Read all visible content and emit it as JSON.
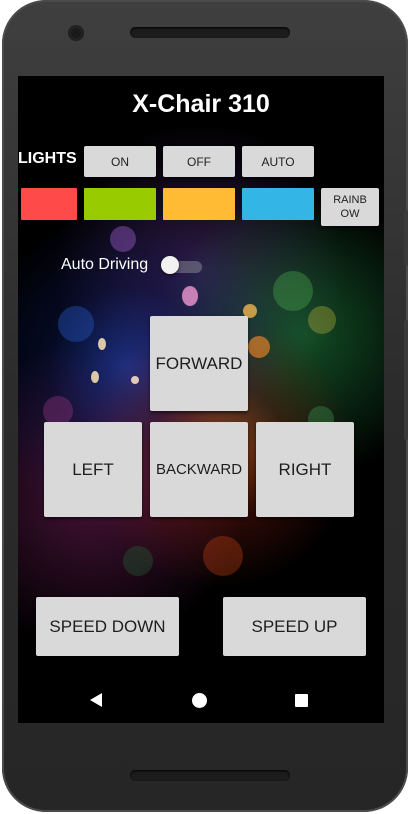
{
  "app": {
    "title": "X-Chair 310"
  },
  "lights": {
    "label": "LIGHTS",
    "on_label": "ON",
    "off_label": "OFF",
    "auto_label": "AUTO",
    "rainbow_label": "RAINB\nOW",
    "colors": [
      "#ff4a4a",
      "#99cc00",
      "#ffbb33",
      "#33b5e5"
    ]
  },
  "auto_driving": {
    "label": "Auto Driving",
    "enabled": false
  },
  "drive": {
    "forward_label": "FORWARD",
    "left_label": "LEFT",
    "backward_label": "BACKWARD",
    "right_label": "RIGHT"
  },
  "speed": {
    "down_label": "SPEED DOWN",
    "up_label": "SPEED UP"
  },
  "navbar": {
    "back_icon": "back-triangle",
    "home_icon": "home-circle",
    "recents_icon": "recents-square"
  }
}
